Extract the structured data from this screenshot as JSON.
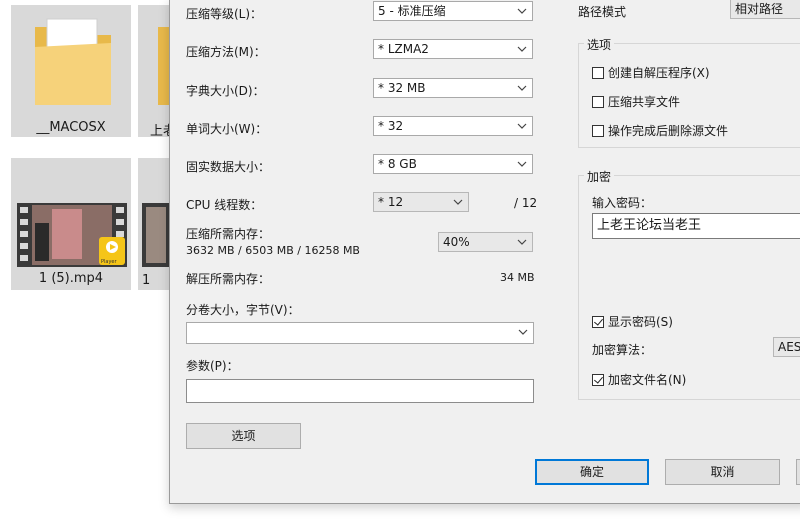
{
  "explorer": {
    "items": [
      {
        "label": "__MACOSX",
        "type": "folder"
      },
      {
        "label": "上老",
        "type": "folder"
      },
      {
        "label": "1 (5).mp4",
        "type": "video"
      },
      {
        "label": "1",
        "type": "video"
      }
    ],
    "player_badge": "Player"
  },
  "dialog": {
    "compression_level": {
      "label": "压缩等级(L)：",
      "value": "5 - 标准压缩"
    },
    "compression_method": {
      "label": "压缩方法(M)：",
      "value": "* LZMA2"
    },
    "dictionary_size": {
      "label": "字典大小(D)：",
      "value": "* 32 MB"
    },
    "word_size": {
      "label": "单词大小(W)：",
      "value": "* 32"
    },
    "solid_block_size": {
      "label": "固实数据大小：",
      "value": "* 8 GB"
    },
    "cpu_threads": {
      "label": "CPU 线程数：",
      "value": "* 12",
      "max": "/ 12"
    },
    "memory_compress": {
      "label": "压缩所需内存：",
      "detail": "3632 MB / 6503 MB / 16258 MB",
      "value": "40%"
    },
    "memory_decompress": {
      "label": "解压所需内存：",
      "value": "34 MB"
    },
    "split_volume": {
      "label": "分卷大小，字节(V)：",
      "value": ""
    },
    "parameters": {
      "label": "参数(P)：",
      "value": ""
    },
    "options_button": "选项",
    "path_mode": {
      "label": "路径模式",
      "value": "相对路径"
    },
    "options_group": {
      "title": "选项",
      "items": [
        {
          "label": "创建自解压程序(X)",
          "checked": false
        },
        {
          "label": "压缩共享文件",
          "checked": false
        },
        {
          "label": "操作完成后删除源文件",
          "checked": false
        }
      ]
    },
    "encryption_group": {
      "title": "加密",
      "password_label": "输入密码：",
      "password_value": "上老王论坛当老王",
      "show_password": {
        "label": "显示密码(S)",
        "checked": true
      },
      "method_label": "加密算法：",
      "method_value": "AES",
      "encrypt_names": {
        "label": "加密文件名(N)",
        "checked": true
      }
    },
    "ok_button": "确定",
    "cancel_button": "取消"
  }
}
